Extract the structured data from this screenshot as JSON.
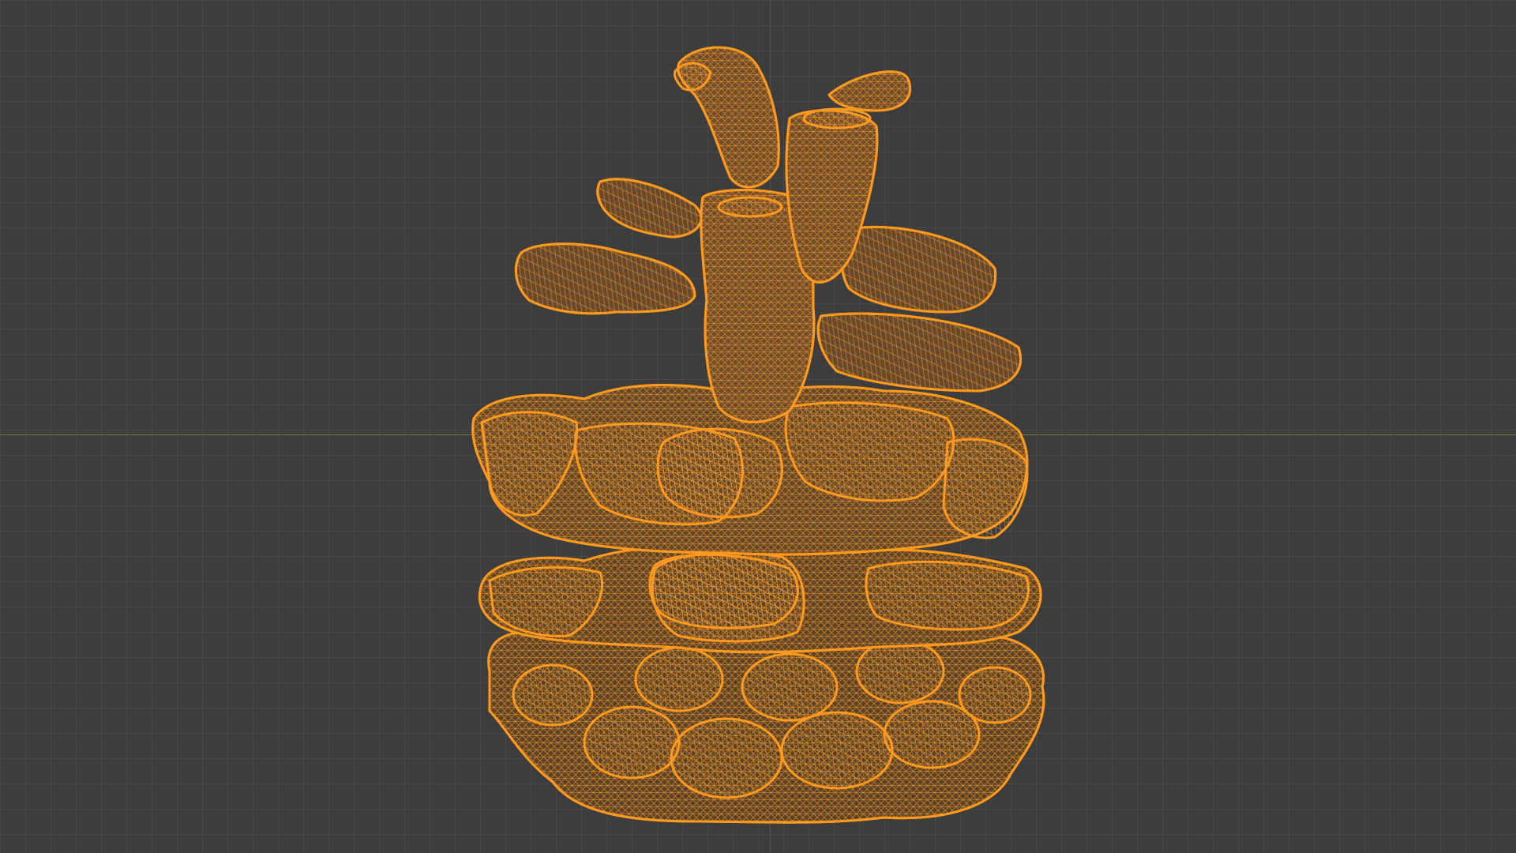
{
  "viewport": {
    "background_color": "#3d3d3d",
    "grid_color": "#4e4e4e",
    "x_axis_color": "#6f7a35",
    "y_axis_color": "#44546d"
  },
  "object": {
    "name": "pine-cone",
    "display_mode": "wireframe",
    "selected": true,
    "selection_color": "#ff9a1e",
    "fill_color": "#6a4a22"
  }
}
